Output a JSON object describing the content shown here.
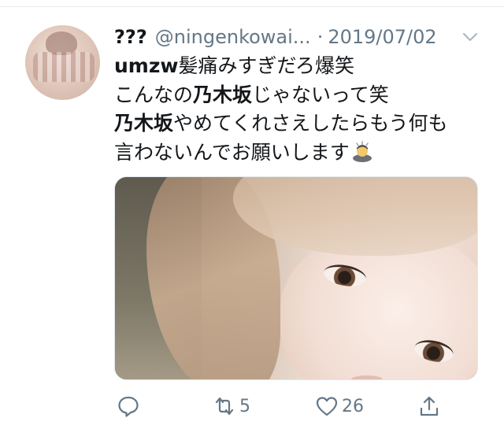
{
  "tweet": {
    "author_name": "???",
    "handle": "@ningenkowai...",
    "separator": "·",
    "date": "2019/07/02",
    "text_lines": [
      {
        "bold": "umzw",
        "rest": "髪痛みすぎだろ爆笑"
      },
      {
        "pre": "こんなの",
        "bold": "乃木坂",
        "post": "じゃないって笑"
      },
      {
        "bold": "乃木坂",
        "rest": "やめてくれさえしたらもう何も"
      },
      {
        "rest": "言わないんでお願いします",
        "emoji": "person-bowing-emoji"
      }
    ]
  },
  "actions": {
    "reply_count": "",
    "retweet_count": "5",
    "like_count": "26"
  },
  "colors": {
    "text": "#14171a",
    "secondary": "#657786",
    "divider": "#e6ecf0"
  },
  "icons": [
    "chevron-down-icon",
    "reply-icon",
    "retweet-icon",
    "heart-icon",
    "share-icon"
  ]
}
